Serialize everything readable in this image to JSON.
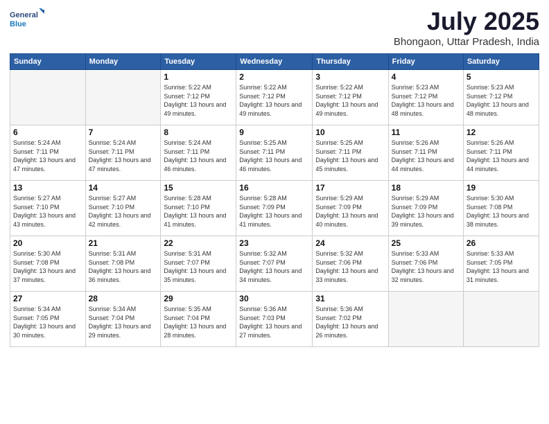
{
  "header": {
    "logo_general": "General",
    "logo_blue": "Blue",
    "title": "July 2025",
    "subtitle": "Bhongaon, Uttar Pradesh, India"
  },
  "calendar": {
    "days_of_week": [
      "Sunday",
      "Monday",
      "Tuesday",
      "Wednesday",
      "Thursday",
      "Friday",
      "Saturday"
    ],
    "weeks": [
      [
        {
          "day": "",
          "info": ""
        },
        {
          "day": "",
          "info": ""
        },
        {
          "day": "1",
          "info": "Sunrise: 5:22 AM\nSunset: 7:12 PM\nDaylight: 13 hours and 49 minutes."
        },
        {
          "day": "2",
          "info": "Sunrise: 5:22 AM\nSunset: 7:12 PM\nDaylight: 13 hours and 49 minutes."
        },
        {
          "day": "3",
          "info": "Sunrise: 5:22 AM\nSunset: 7:12 PM\nDaylight: 13 hours and 49 minutes."
        },
        {
          "day": "4",
          "info": "Sunrise: 5:23 AM\nSunset: 7:12 PM\nDaylight: 13 hours and 48 minutes."
        },
        {
          "day": "5",
          "info": "Sunrise: 5:23 AM\nSunset: 7:12 PM\nDaylight: 13 hours and 48 minutes."
        }
      ],
      [
        {
          "day": "6",
          "info": "Sunrise: 5:24 AM\nSunset: 7:11 PM\nDaylight: 13 hours and 47 minutes."
        },
        {
          "day": "7",
          "info": "Sunrise: 5:24 AM\nSunset: 7:11 PM\nDaylight: 13 hours and 47 minutes."
        },
        {
          "day": "8",
          "info": "Sunrise: 5:24 AM\nSunset: 7:11 PM\nDaylight: 13 hours and 46 minutes."
        },
        {
          "day": "9",
          "info": "Sunrise: 5:25 AM\nSunset: 7:11 PM\nDaylight: 13 hours and 46 minutes."
        },
        {
          "day": "10",
          "info": "Sunrise: 5:25 AM\nSunset: 7:11 PM\nDaylight: 13 hours and 45 minutes."
        },
        {
          "day": "11",
          "info": "Sunrise: 5:26 AM\nSunset: 7:11 PM\nDaylight: 13 hours and 44 minutes."
        },
        {
          "day": "12",
          "info": "Sunrise: 5:26 AM\nSunset: 7:11 PM\nDaylight: 13 hours and 44 minutes."
        }
      ],
      [
        {
          "day": "13",
          "info": "Sunrise: 5:27 AM\nSunset: 7:10 PM\nDaylight: 13 hours and 43 minutes."
        },
        {
          "day": "14",
          "info": "Sunrise: 5:27 AM\nSunset: 7:10 PM\nDaylight: 13 hours and 42 minutes."
        },
        {
          "day": "15",
          "info": "Sunrise: 5:28 AM\nSunset: 7:10 PM\nDaylight: 13 hours and 41 minutes."
        },
        {
          "day": "16",
          "info": "Sunrise: 5:28 AM\nSunset: 7:09 PM\nDaylight: 13 hours and 41 minutes."
        },
        {
          "day": "17",
          "info": "Sunrise: 5:29 AM\nSunset: 7:09 PM\nDaylight: 13 hours and 40 minutes."
        },
        {
          "day": "18",
          "info": "Sunrise: 5:29 AM\nSunset: 7:09 PM\nDaylight: 13 hours and 39 minutes."
        },
        {
          "day": "19",
          "info": "Sunrise: 5:30 AM\nSunset: 7:08 PM\nDaylight: 13 hours and 38 minutes."
        }
      ],
      [
        {
          "day": "20",
          "info": "Sunrise: 5:30 AM\nSunset: 7:08 PM\nDaylight: 13 hours and 37 minutes."
        },
        {
          "day": "21",
          "info": "Sunrise: 5:31 AM\nSunset: 7:08 PM\nDaylight: 13 hours and 36 minutes."
        },
        {
          "day": "22",
          "info": "Sunrise: 5:31 AM\nSunset: 7:07 PM\nDaylight: 13 hours and 35 minutes."
        },
        {
          "day": "23",
          "info": "Sunrise: 5:32 AM\nSunset: 7:07 PM\nDaylight: 13 hours and 34 minutes."
        },
        {
          "day": "24",
          "info": "Sunrise: 5:32 AM\nSunset: 7:06 PM\nDaylight: 13 hours and 33 minutes."
        },
        {
          "day": "25",
          "info": "Sunrise: 5:33 AM\nSunset: 7:06 PM\nDaylight: 13 hours and 32 minutes."
        },
        {
          "day": "26",
          "info": "Sunrise: 5:33 AM\nSunset: 7:05 PM\nDaylight: 13 hours and 31 minutes."
        }
      ],
      [
        {
          "day": "27",
          "info": "Sunrise: 5:34 AM\nSunset: 7:05 PM\nDaylight: 13 hours and 30 minutes."
        },
        {
          "day": "28",
          "info": "Sunrise: 5:34 AM\nSunset: 7:04 PM\nDaylight: 13 hours and 29 minutes."
        },
        {
          "day": "29",
          "info": "Sunrise: 5:35 AM\nSunset: 7:04 PM\nDaylight: 13 hours and 28 minutes."
        },
        {
          "day": "30",
          "info": "Sunrise: 5:36 AM\nSunset: 7:03 PM\nDaylight: 13 hours and 27 minutes."
        },
        {
          "day": "31",
          "info": "Sunrise: 5:36 AM\nSunset: 7:02 PM\nDaylight: 13 hours and 26 minutes."
        },
        {
          "day": "",
          "info": ""
        },
        {
          "day": "",
          "info": ""
        }
      ]
    ]
  }
}
